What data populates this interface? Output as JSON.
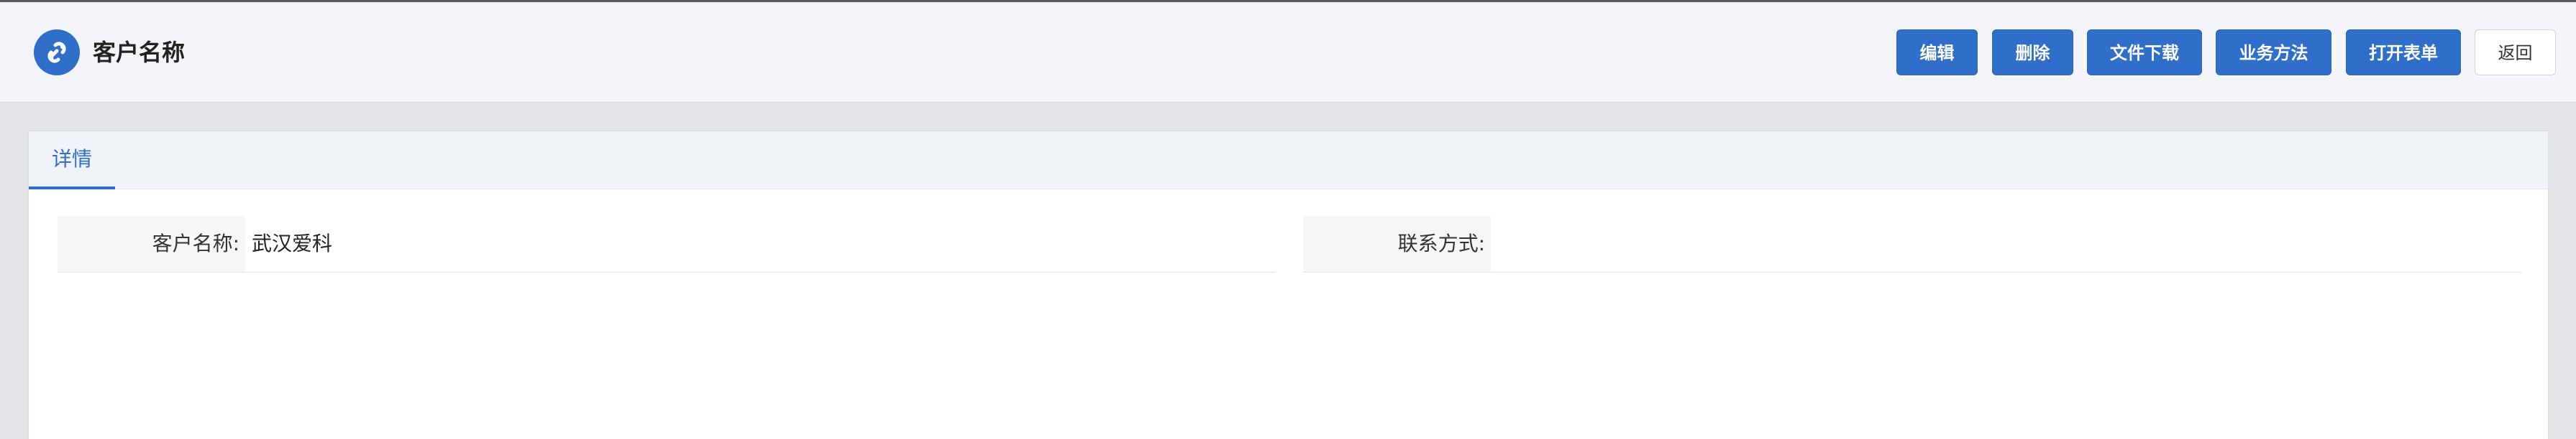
{
  "header": {
    "title": "客户名称",
    "logo_icon": "link-icon",
    "accent_color": "#2f6fc9"
  },
  "toolbar": {
    "edit_label": "编辑",
    "delete_label": "删除",
    "download_label": "文件下载",
    "business_label": "业务方法",
    "open_form_label": "打开表单",
    "back_label": "返回"
  },
  "tabs": [
    {
      "label": "详情",
      "active": true
    }
  ],
  "fields": [
    {
      "label": "客户名称:",
      "value": "武汉爱科"
    },
    {
      "label": "联系方式:",
      "value": ""
    }
  ]
}
